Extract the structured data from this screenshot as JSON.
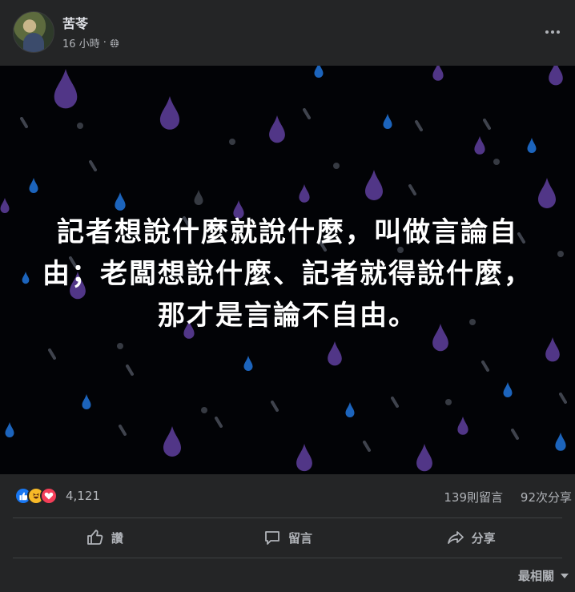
{
  "post": {
    "author": "苦苓",
    "time": "16 小時",
    "separator": "·",
    "privacy_icon": "globe-icon",
    "more_icon": "more-dots-icon"
  },
  "image": {
    "quote_lines": [
      "記者想說什麼就說什麼，叫做言論自",
      "由；老闆想說什麼、記者就得說什麼，",
      "那才是言論不自由。"
    ],
    "background_color": "#020306",
    "drop_colors": [
      "#5a3c96",
      "#1f6fd0",
      "#5a5f6b"
    ]
  },
  "stats": {
    "reaction_icons": [
      "like-icon",
      "haha-icon",
      "love-icon"
    ],
    "reactions_count": "4,121",
    "comments": "139則留言",
    "shares": "92次分享"
  },
  "actions": {
    "like": "讚",
    "comment": "留言",
    "share": "分享"
  },
  "sort": {
    "label": "最相關"
  },
  "colors": {
    "card_bg": "#242526",
    "text_primary": "#e4e6eb",
    "text_secondary": "#b0b3b8",
    "like_blue": "#1877f2"
  }
}
